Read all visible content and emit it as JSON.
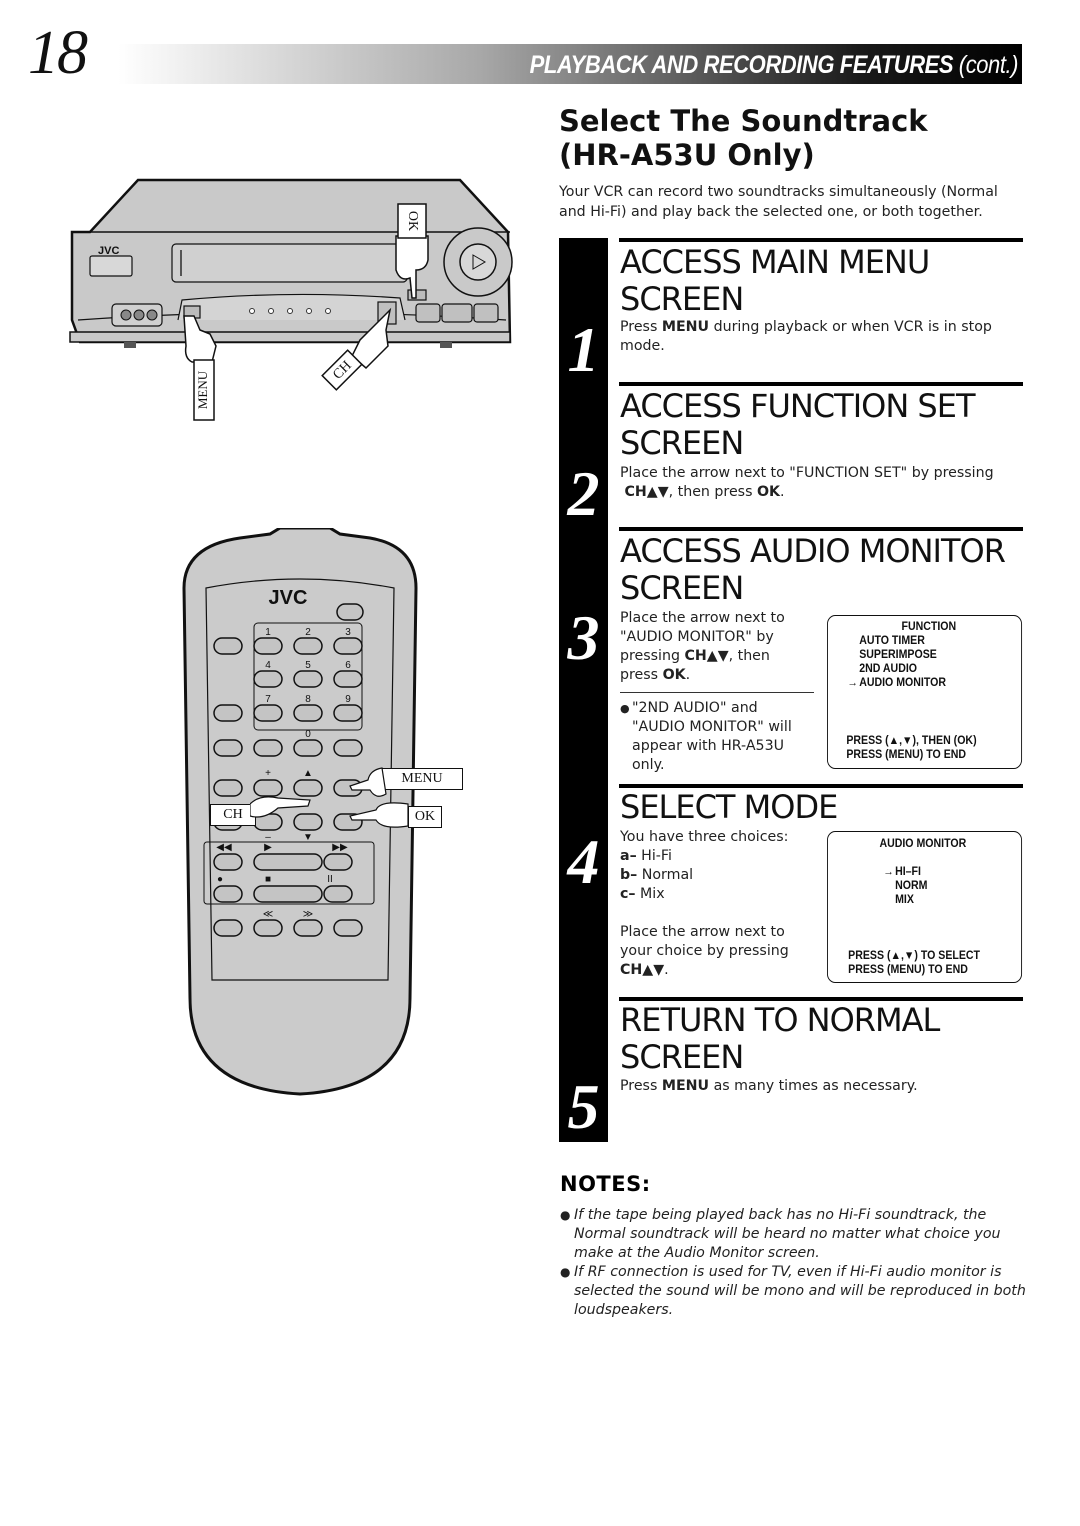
{
  "header": {
    "page_number": "18",
    "title_main": "PLAYBACK AND RECORDING FEATURES",
    "title_suffix": "(cont.)"
  },
  "section": {
    "title_line1": "Select The Soundtrack",
    "title_line2": "(HR-A53U Only)",
    "intro": "Your VCR can record two soundtracks simultaneously (Normal and Hi-Fi) and play back the selected one, or both together."
  },
  "illustrations": {
    "vcr": {
      "brand": "JVC",
      "label_ok": "OK",
      "label_menu": "MENU",
      "label_ch": "CH"
    },
    "remote": {
      "brand": "JVC",
      "keys": [
        "1",
        "2",
        "3",
        "4",
        "5",
        "6",
        "7",
        "8",
        "9",
        "0"
      ],
      "label_menu": "MENU",
      "label_ok": "OK",
      "label_ch": "CH",
      "plus": "+",
      "minus": "–",
      "rew": "◀◀",
      "play": "▶",
      "ff": "▶▶",
      "rec": "●",
      "stop": "■",
      "pause": "II",
      "skip_back": "≪",
      "skip_fwd": "≫"
    }
  },
  "steps": [
    {
      "number": "1",
      "heading_line1": "ACCESS MAIN MENU",
      "heading_line2": "SCREEN",
      "body_pre": "Press ",
      "body_bold": "MENU",
      "body_post": " during playback or when VCR is in stop mode."
    },
    {
      "number": "2",
      "heading_line1": "ACCESS FUNCTION SET",
      "heading_line2": "SCREEN",
      "body_line1": "Place the arrow next to \"FUNCTION SET\" by pressing",
      "body_bold1": "CH▲▼",
      "body_mid": ", then press ",
      "body_bold2": "OK",
      "body_end": "."
    },
    {
      "number": "3",
      "heading_line1": "ACCESS AUDIO MONITOR",
      "heading_line2": "SCREEN",
      "body_l1": "Place the arrow next to",
      "body_l2": "\"AUDIO MONITOR\" by",
      "body_l3_pre": "pressing ",
      "body_l3_bold": "CH▲▼",
      "body_l3_post": ", then",
      "body_l4_pre": "press ",
      "body_l4_bold": "OK",
      "body_l4_post": ".",
      "note_l1": "\"2ND AUDIO\" and",
      "note_l2": "\"AUDIO MONITOR\" will",
      "note_l3": "appear with HR-A53U",
      "note_l4": "only.",
      "osd": {
        "title": "FUNCTION",
        "items": [
          "AUTO TIMER",
          "SUPERIMPOSE",
          "2ND AUDIO",
          "AUDIO MONITOR"
        ],
        "selected_index": 3,
        "arrow": "→",
        "footer1": "PRESS (▲,▼), THEN (OK)",
        "footer2": "PRESS (MENU) TO END"
      }
    },
    {
      "number": "4",
      "heading_line1": "SELECT MODE",
      "body_intro": "You have three choices:",
      "choices": [
        {
          "key": "a–",
          "label": " Hi-Fi"
        },
        {
          "key": "b–",
          "label": " Normal"
        },
        {
          "key": "c–",
          "label": " Mix"
        }
      ],
      "body_l1": "Place the arrow next to",
      "body_l2": "your choice by pressing",
      "body_bold": "CH▲▼",
      "body_end": ".",
      "osd": {
        "title": "AUDIO MONITOR",
        "items": [
          "HI–FI",
          "NORM",
          "MIX"
        ],
        "selected_index": 0,
        "arrow": "→",
        "footer1": "PRESS (▲,▼) TO SELECT",
        "footer2": "PRESS (MENU) TO END"
      }
    },
    {
      "number": "5",
      "heading_line1": "RETURN TO NORMAL",
      "heading_line2": "SCREEN",
      "body_pre": "Press ",
      "body_bold": "MENU",
      "body_post": " as many times as necessary."
    }
  ],
  "notes": {
    "title": "NOTES:",
    "bullet": "●",
    "items": [
      "If the tape being played back has no Hi-Fi soundtrack, the Normal soundtrack will be heard no matter what choice you make at the Audio Monitor screen.",
      "If RF connection is used for TV, even if Hi-Fi audio monitor is selected the sound will be mono and will be reproduced in both loudspeakers."
    ]
  }
}
